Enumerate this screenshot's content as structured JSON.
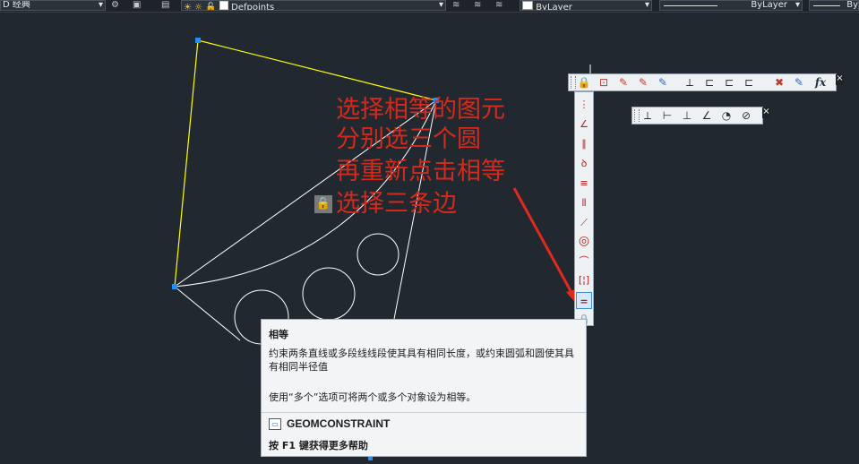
{
  "topbar": {
    "workspace_value": "D 经典",
    "layer_value": "Defpoints",
    "color_value": "ByLayer",
    "linetype_value": "ByLayer",
    "lineweight_value": "By"
  },
  "annotation": {
    "lines": [
      "选择相等的图元",
      "分别选三个圆",
      "再重新点击相等",
      "选择三条边"
    ],
    "color": "#d42a1c"
  },
  "constraint_glyph": "🔒",
  "geometric_toolbar": {
    "buttons": [
      "fix-icon",
      "coincident-icon",
      "horizontal-icon",
      "vertical-icon",
      "tangent-icon",
      "aligned-icon",
      "linear-icon",
      "linear-alt-icon",
      "show-icon",
      "delete-constraints-icon",
      "parameters-icon",
      "fx-icon"
    ],
    "fx_label": "fx",
    "close": "×"
  },
  "dimensional_toolbar": {
    "buttons": [
      "aligned-dim-icon",
      "horizontal-dim-icon",
      "vertical-dim-icon",
      "angular-dim-icon",
      "radial-dim-icon",
      "diameter-dim-icon"
    ],
    "close": "×"
  },
  "vertical_toolbar": {
    "buttons": [
      "coincident-icon",
      "perpendicular-icon",
      "parallel-icon",
      "tangent-icon",
      "horizontal-icon",
      "vertical-icon",
      "colinear-icon",
      "concentric-icon",
      "smooth-icon",
      "symmetric-icon",
      "equal-icon",
      "fix-icon"
    ],
    "active": "equal-icon"
  },
  "tooltip": {
    "title": "相等",
    "description": "约束两条直线或多段线线段使其具有相同长度，或约束圆弧和圆使其具有相同半径值",
    "hint": "使用“多个”选项可将两个或多个对象设为相等。",
    "command": "GEOMCONSTRAINT",
    "help": "按 F1 键获得更多帮助"
  },
  "colors": {
    "canvas_bg": "#212830",
    "geometry": "#ffffff",
    "yellow_line": "#ffff00",
    "grip": "#1e90ff",
    "arrow": "#e02a1f"
  }
}
